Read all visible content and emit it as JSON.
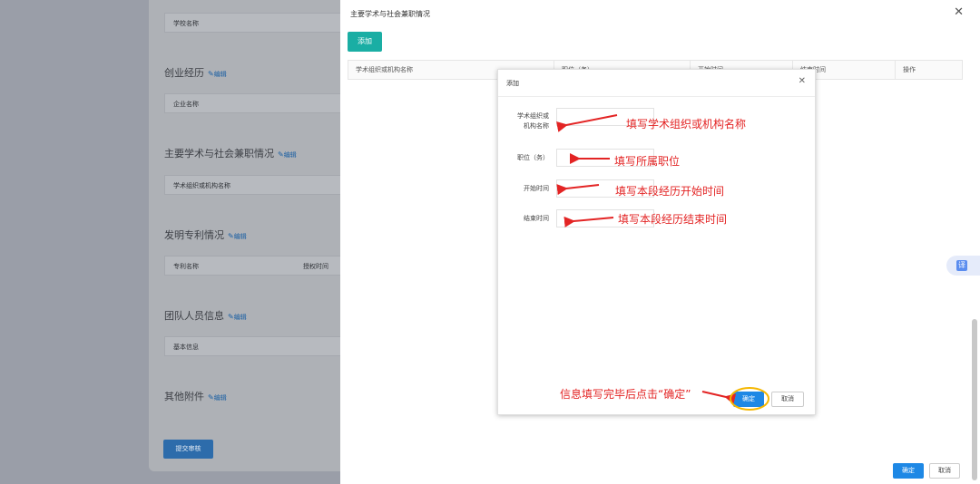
{
  "left_panel": {
    "school_row": "学校名称",
    "sections": [
      {
        "title": "创业经历",
        "edit": "编辑",
        "row": "企业名称"
      },
      {
        "title": "主要学术与社会兼职情况",
        "edit": "编辑",
        "row": "学术组织或机构名称"
      },
      {
        "title": "发明专利情况",
        "edit": "编辑",
        "row": "专利名称",
        "row_col2": "授权时间"
      },
      {
        "title": "团队人员信息",
        "edit": "编辑",
        "row": "基本信息"
      },
      {
        "title": "其他附件",
        "edit": "编辑"
      }
    ],
    "submit": "提交审核"
  },
  "drawer": {
    "title": "主要学术与社会兼职情况",
    "add": "添加",
    "columns": [
      "学术组织或机构名称",
      "职位（务）",
      "开始时间",
      "结束时间",
      "操作"
    ],
    "ok": "确定",
    "cancel": "取消"
  },
  "dialog": {
    "title": "添加",
    "fields": [
      {
        "label_line1": "学术组织或",
        "label_line2": "机构名称",
        "value": ""
      },
      {
        "label": "职位（务）",
        "value": ""
      },
      {
        "label": "开始时间",
        "value": ""
      },
      {
        "label": "结束时间",
        "value": ""
      }
    ],
    "ok": "确定",
    "cancel": "取消"
  },
  "annotations": {
    "a1": "填写学术组织或机构名称",
    "a2": "填写所属职位",
    "a3": "填写本段经历开始时间",
    "a4": "填写本段经历结束时间",
    "a5": "信息填写完毕后点击“确定”"
  },
  "translate_icon": "译",
  "colors": {
    "accent": "#1aaea4",
    "primary": "#1e88e5",
    "annotation": "#e32424",
    "highlight": "#f5b700"
  }
}
